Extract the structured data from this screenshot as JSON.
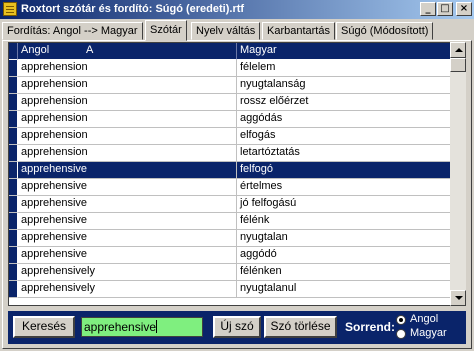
{
  "window": {
    "title": "Roxtort szótár és fordító: Súgó (eredeti).rtf",
    "icon": "dictionary-icon",
    "controls": [
      "minimize",
      "maximize",
      "close"
    ],
    "control_glyphs": {
      "minimize": "_",
      "maximize": "□",
      "close": "×"
    }
  },
  "tabs": [
    {
      "label": "Fordítás: Angol --> Magyar"
    },
    {
      "label": "Szótár",
      "active": true
    },
    {
      "label": "Nyelv váltás"
    },
    {
      "label": "Karbantartás"
    },
    {
      "label": "Súgó (Módosított)"
    }
  ],
  "grid": {
    "columns": [
      "Angol",
      "A",
      "Magyar"
    ],
    "selected_row": 6,
    "rows": [
      {
        "en": "apprehension",
        "hu": "félelem"
      },
      {
        "en": "apprehension",
        "hu": "nyugtalanság"
      },
      {
        "en": "apprehension",
        "hu": "rossz előérzet"
      },
      {
        "en": "apprehension",
        "hu": "aggódás"
      },
      {
        "en": "apprehension",
        "hu": "elfogás"
      },
      {
        "en": "apprehension",
        "hu": "letartóztatás"
      },
      {
        "en": "apprehensive",
        "hu": "felfogó"
      },
      {
        "en": "apprehensive",
        "hu": "értelmes"
      },
      {
        "en": "apprehensive",
        "hu": "jó felfogású"
      },
      {
        "en": "apprehensive",
        "hu": "félénk"
      },
      {
        "en": "apprehensive",
        "hu": "nyugtalan"
      },
      {
        "en": "apprehensive",
        "hu": "aggódó"
      },
      {
        "en": "apprehensively",
        "hu": "félénken"
      },
      {
        "en": "apprehensively",
        "hu": "nyugtalanul"
      }
    ]
  },
  "bottom": {
    "search_button": "Keresés",
    "search_value": "apprehensive",
    "new_word_button": "Új szó",
    "delete_word_button": "Szó törlése",
    "order_label": "Sorrend:",
    "order_options": [
      {
        "label": "Angol",
        "checked": true
      },
      {
        "label": "Magyar",
        "checked": false
      }
    ]
  },
  "colors": {
    "accent": "#0a246a",
    "search_bg": "#7fef7f",
    "face": "#d4d0c8"
  }
}
